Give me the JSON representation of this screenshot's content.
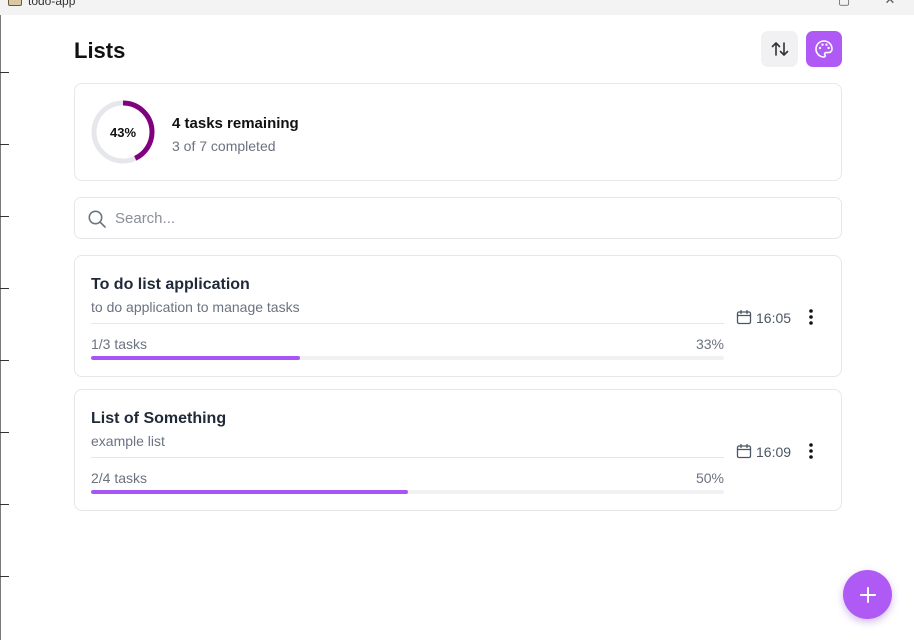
{
  "window": {
    "title": "todo-app"
  },
  "header": {
    "title": "Lists",
    "sort_icon": "sort-arrows-icon",
    "theme_icon": "palette-icon"
  },
  "summary": {
    "percent_label": "43%",
    "percent": 43,
    "remaining": "4 tasks remaining",
    "completed": "3 of 7 completed"
  },
  "search": {
    "placeholder": "Search...",
    "value": ""
  },
  "lists": [
    {
      "title": "To do list application",
      "description": "to do application to manage tasks",
      "count": "1/3 tasks",
      "percent_label": "33%",
      "progress": 0.33,
      "time": "16:05"
    },
    {
      "title": "List of Something",
      "description": "example list",
      "count": "2/4 tasks",
      "percent_label": "50%",
      "progress": 0.5,
      "time": "16:09"
    }
  ],
  "colors": {
    "accent": "#a855f7",
    "ring": "#800080",
    "ring_track": "#e5e7eb"
  },
  "fab": {
    "icon": "plus-icon"
  }
}
